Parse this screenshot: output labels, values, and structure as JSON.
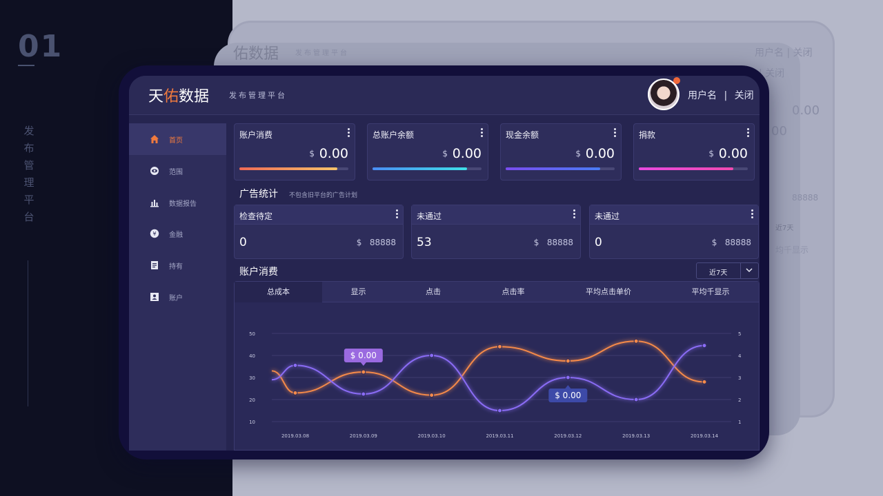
{
  "slide": {
    "number": "01",
    "vertical_title": [
      "发",
      "布",
      "管",
      "理",
      "平",
      "台"
    ]
  },
  "ghost": {
    "brand": "佑数据",
    "sub": "发布管理平台",
    "user": "用户名 | 关闭",
    "user2": "| 关闭",
    "amount1": "0.00",
    "amount2": "00",
    "num": "88888",
    "range": "近7天",
    "hint": "均千显示"
  },
  "brand": {
    "part1": "天",
    "accent": "佑",
    "part2": "数据",
    "subtitle": "发布管理平台"
  },
  "user": {
    "name": "用户名",
    "separator": "|",
    "close": "关闭"
  },
  "sidebar": {
    "items": [
      {
        "label": "首页",
        "icon": "home-icon"
      },
      {
        "label": "范围",
        "icon": "eye-icon"
      },
      {
        "label": "数据报告",
        "icon": "bar-chart-icon"
      },
      {
        "label": "金融",
        "icon": "yen-icon"
      },
      {
        "label": "持有",
        "icon": "document-icon"
      },
      {
        "label": "账户",
        "icon": "user-card-icon"
      }
    ]
  },
  "summary_cards": [
    {
      "title": "账户消费",
      "currency": "$",
      "amount": "0.00",
      "fill": 0.9,
      "gradient": [
        "#f06a55",
        "#f5c46a"
      ]
    },
    {
      "title": "总账户余额",
      "currency": "$",
      "amount": "0.00",
      "fill": 0.87,
      "gradient": [
        "#4a8ef5",
        "#3fe0e8"
      ]
    },
    {
      "title": "现金余额",
      "currency": "$",
      "amount": "0.00",
      "fill": 0.87,
      "gradient": [
        "#7a4cf0",
        "#4a7cf5"
      ]
    },
    {
      "title": "捐款",
      "currency": "$",
      "amount": "0.00",
      "fill": 0.87,
      "gradient": [
        "#e84ae0",
        "#f04ab0"
      ]
    }
  ],
  "ad_stats": {
    "title": "广告统计",
    "subtitle": "不包含旧平台的广告计划",
    "cards": [
      {
        "title": "检查待定",
        "value": "0",
        "currency": "$",
        "total": "88888"
      },
      {
        "title": "未通过",
        "value": "53",
        "currency": "$",
        "total": "88888"
      },
      {
        "title": "未通过",
        "value": "0",
        "currency": "$",
        "total": "88888"
      }
    ]
  },
  "consumption": {
    "title": "账户消费",
    "range": "近7天",
    "tabs": [
      "总成本",
      "显示",
      "点击",
      "点击率",
      "平均点击单价",
      "平均千显示"
    ]
  },
  "chart_data": {
    "type": "line",
    "x": [
      "2019.03.08",
      "2019.03.09",
      "2019.03.10",
      "2019.03.11",
      "2019.03.12",
      "2019.03.13",
      "2019.03.14"
    ],
    "y_left_ticks": [
      "50",
      "40",
      "30",
      "20",
      "10"
    ],
    "y_right_ticks": [
      "5",
      "4",
      "3",
      "2",
      "1"
    ],
    "ylim_left": [
      10,
      50
    ],
    "ylim_right": [
      1,
      5
    ],
    "series": [
      {
        "color": "#f58a4a",
        "axis": "left",
        "start": 33,
        "values": [
          23,
          32.5,
          22,
          44,
          37.5,
          46.5,
          28
        ]
      },
      {
        "color": "#8a6cf5",
        "axis": "left",
        "start": 29,
        "values": [
          35.5,
          22.5,
          40,
          15,
          30,
          20,
          44.5
        ]
      }
    ],
    "tooltips": [
      {
        "text": "$ 0.00",
        "series": 0,
        "index": 1,
        "color": "#9a6ae0"
      },
      {
        "text": "$ 0.00",
        "series": 1,
        "index": 4,
        "color": "#3d4aa8"
      }
    ],
    "grid": true
  }
}
